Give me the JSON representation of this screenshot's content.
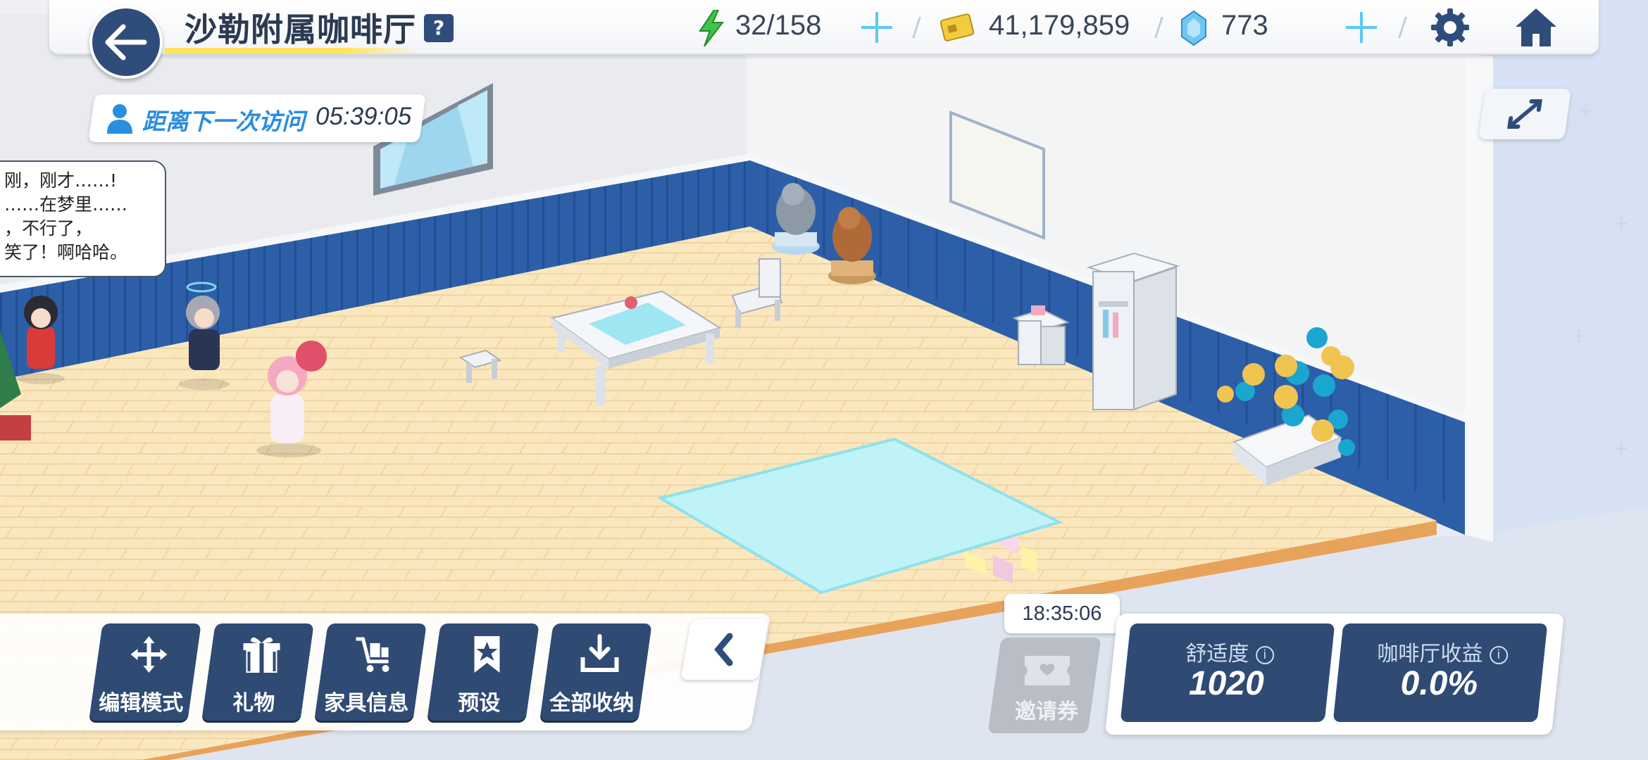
{
  "header": {
    "title": "沙勒附属咖啡厅",
    "help_label": "?",
    "stamina": "32/158",
    "credits": "41,179,859",
    "pyroxene": "773"
  },
  "visit": {
    "label": "距离下一次访问",
    "time": "05:39:05"
  },
  "speech": {
    "lines": [
      "刚，刚才……!",
      "……在梦里……",
      "，不行了，",
      "笑了！啊哈哈。"
    ]
  },
  "toolbar": {
    "edit_mode": "编辑模式",
    "gift": "礼物",
    "furniture_info": "家具信息",
    "preset": "预设",
    "store_all": "全部收纳"
  },
  "invitation": {
    "timer": "18:35:06",
    "label": "邀请券"
  },
  "stats": {
    "comfort_label": "舒适度",
    "comfort_value": "1020",
    "revenue_label": "咖啡厅收益",
    "revenue_value": "0.0%"
  },
  "colors": {
    "navy": "#2f4b74",
    "wall_blue": "#2c5fa8",
    "floor": "#fbe5b8",
    "accent_yellow": "#ffe35a",
    "plus_cyan": "#5cc9f1"
  }
}
